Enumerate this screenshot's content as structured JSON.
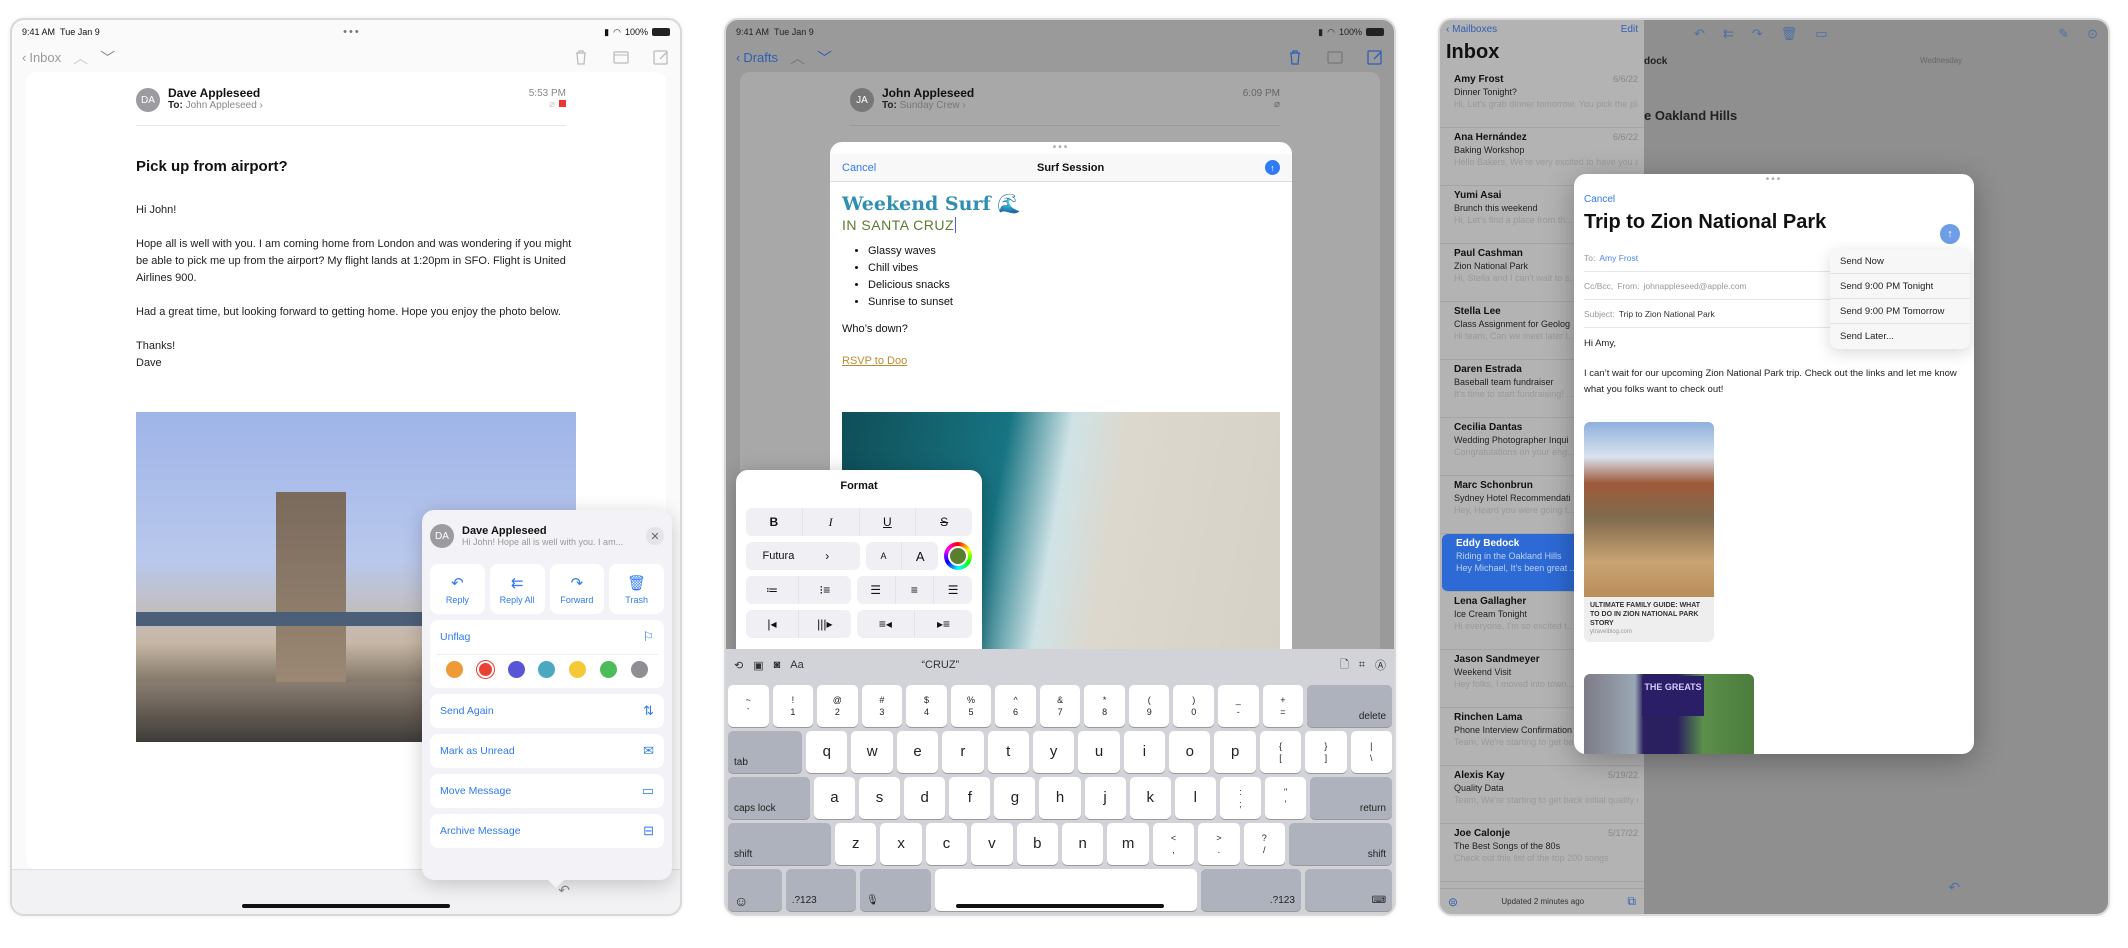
{
  "status_bar": {
    "time": "9:41 AM",
    "date": "Tue Jan 9",
    "battery": "100%"
  },
  "panel1": {
    "nav": {
      "back_label": "Inbox"
    },
    "message": {
      "avatar_initials": "DA",
      "sender": "Dave Appleseed",
      "to_label": "To:",
      "to": "John Appleseed",
      "time": "5:53 PM",
      "subject": "Pick up from airport?",
      "body": [
        "Hi John!",
        "Hope all is well with you. I am coming home from London and was wondering if you might be able to pick me up from the airport? My flight lands at 1:20pm in SFO. Flight is United Airlines 900.",
        "Had a great time, but looking forward to getting home. Hope you enjoy the photo below.",
        "Thanks!\nDave"
      ]
    },
    "popover": {
      "sender": "Dave Appleseed",
      "preview": "Hi John! Hope all is well with you. I am...",
      "close_glyph": "✕",
      "actions": [
        {
          "label": "Reply",
          "icon": "reply-icon",
          "glyph": "↶"
        },
        {
          "label": "Reply All",
          "icon": "reply-all-icon",
          "glyph": "⇇"
        },
        {
          "label": "Forward",
          "icon": "forward-icon",
          "glyph": "↷"
        },
        {
          "label": "Trash",
          "icon": "trash-icon",
          "glyph": "🗑"
        }
      ],
      "unflag_label": "Unflag",
      "flag_colors": [
        "#f09a37",
        "#eb4034",
        "#5856d6",
        "#4aa8c0",
        "#f5c935",
        "#4cbb5a",
        "#8e8e93"
      ],
      "selected_flag_color": "#eb4034",
      "menu": [
        {
          "label": "Send Again",
          "icon": "send-again-icon",
          "glyph": "⇅"
        },
        {
          "label": "Mark as Unread",
          "icon": "envelope-unread-icon",
          "glyph": "✉"
        },
        {
          "label": "Move Message",
          "icon": "folder-icon",
          "glyph": "▭"
        },
        {
          "label": "Archive Message",
          "icon": "archive-box-icon",
          "glyph": "⊟"
        }
      ]
    }
  },
  "panel2": {
    "nav": {
      "back_label": "Drafts"
    },
    "message": {
      "avatar_initials": "JA",
      "sender": "John Appleseed",
      "to_label": "To:",
      "to": "Sunday Crew",
      "time": "6:09 PM"
    },
    "compose": {
      "cancel_label": "Cancel",
      "title": "Surf Session",
      "heading": "Weekend Surf 🌊",
      "subheading": "IN SANTA CRUZ",
      "bullets": [
        "Glassy waves",
        "Chill vibes",
        "Delicious snacks",
        "Sunrise to sunset"
      ],
      "question": "Who’s down?",
      "link": "RSVP to Doo"
    },
    "format": {
      "title": "Format",
      "styles": [
        "B",
        "I",
        "U",
        "S"
      ],
      "font": "Futura",
      "size_small": "A",
      "size_large": "A",
      "text_color": "#5b7d2e"
    },
    "keyboard": {
      "suggestion": "“CRUZ”",
      "toolbar_aa": "Aa",
      "row1": [
        [
          "~",
          "`"
        ],
        [
          "!",
          "1"
        ],
        [
          "@",
          "2"
        ],
        [
          "#",
          "3"
        ],
        [
          "$",
          "4"
        ],
        [
          "%",
          "5"
        ],
        [
          "^",
          "6"
        ],
        [
          "&",
          "7"
        ],
        [
          "*",
          "8"
        ],
        [
          "(",
          "9"
        ],
        [
          ")",
          "0"
        ],
        [
          "_",
          "-"
        ],
        [
          "+",
          "="
        ]
      ],
      "delete": "delete",
      "tab": "tab",
      "row2": [
        "q",
        "w",
        "e",
        "r",
        "t",
        "y",
        "u",
        "i",
        "o",
        "p"
      ],
      "row2_extra": [
        [
          "{",
          "["
        ],
        [
          "}",
          "]"
        ],
        [
          "|",
          "\\"
        ]
      ],
      "caps": "caps lock",
      "row3": [
        "a",
        "s",
        "d",
        "f",
        "g",
        "h",
        "j",
        "k",
        "l"
      ],
      "row3_extra": [
        [
          ":",
          ";"
        ],
        [
          "\"",
          "'"
        ]
      ],
      "return": "return",
      "shift": "shift",
      "row4": [
        "z",
        "x",
        "c",
        "v",
        "b",
        "n",
        "m"
      ],
      "row4_extra": [
        [
          "<",
          ","
        ],
        [
          ">",
          "."
        ],
        [
          "?",
          "/"
        ]
      ],
      "numbers": ".?123"
    }
  },
  "panel3": {
    "sidebar": {
      "back_label": "Mailboxes",
      "edit_label": "Edit",
      "title": "Inbox",
      "footer": "Updated 2 minutes ago",
      "items": [
        {
          "from": "Amy Frost",
          "date": "6/6/22",
          "subject": "Dinner Tonight?",
          "preview": "Hi, Let's grab dinner tomorrow. You pick the place!"
        },
        {
          "from": "Ana Hernández",
          "date": "6/6/22",
          "subject": "Baking Workshop",
          "preview": "Hello Bakers, We're very excited to have you all join us for our baking work..."
        },
        {
          "from": "Yumi Asai",
          "date": "",
          "subject": "Brunch this weekend",
          "preview": "Hi, Let's find a place from th... this weekend. I can't want to..."
        },
        {
          "from": "Paul Cashman",
          "date": "",
          "subject": "Zion National Park",
          "preview": "Hi, Stella and I can't wait to s... week at Zion. I'm including s..."
        },
        {
          "from": "Stella Lee",
          "date": "",
          "subject": "Class Assignment for Geolog",
          "preview": "Hi team, Can we meet later t... started on our final team pro..."
        },
        {
          "from": "Daren Estrada",
          "date": "",
          "subject": "Baseball team fundraiser",
          "preview": "It's time to start fundraising! ... some examples on fundraisi..."
        },
        {
          "from": "Cecilia Dantas",
          "date": "",
          "subject": "Wedding Photographer Inqui",
          "preview": "Congratulations on your eng... thank you for your interest in..."
        },
        {
          "from": "Marc Schonbrun",
          "date": "",
          "subject": "Sydney Hotel Recommendati",
          "preview": "Hey, Heard you were going t... Sydney, Australia next month..."
        },
        {
          "from": "Eddy Bedock",
          "date": "",
          "subject": "Riding in the Oakland Hills",
          "preview": "Hey Michael, It's been great ... riding weather lately, perfect...",
          "selected": true
        },
        {
          "from": "Lena Gallagher",
          "date": "",
          "subject": "Ice Cream Tonight",
          "preview": "Hi everyone, I'm so excited t... tonight. Parking can be toug..."
        },
        {
          "from": "Jason Sandmeyer",
          "date": "",
          "subject": "Weekend Visit",
          "preview": "Hey folks, I moved into town... starting next week. How's ev..."
        },
        {
          "from": "Rinchen Lama",
          "date": "",
          "subject": "Phone Interview Confirmation",
          "preview": "Team, We're starting to get back initial quality da..."
        },
        {
          "from": "Alexis Kay",
          "date": "5/19/22",
          "subject": "Quality Data",
          "preview": "Team, We're starting to get back initial quality data from our partners and early te..."
        },
        {
          "from": "Joe Calonje",
          "date": "5/17/22",
          "subject": "The Best Songs of the 80s",
          "preview": "Check out this list of the top 200 songs"
        }
      ]
    },
    "detail": {
      "from_partial": "dock",
      "day": "Wednesday",
      "subject_partial": "e Oakland Hills"
    },
    "compose": {
      "cancel_label": "Cancel",
      "title": "Trip to Zion National Park",
      "to_label": "To:",
      "to": "Amy Frost",
      "ccbcc_label": "Cc/Bcc,",
      "from_label": "From:",
      "from": "johnappleseed@apple.com",
      "subject_label": "Subject:",
      "subject": "Trip to Zion National Park",
      "greeting": "Hi Amy,",
      "body": "I can’t wait for our upcoming Zion National Park trip.  Check out the links and let me know what you folks want to check out!",
      "link_title": "ULTIMATE FAMILY GUIDE: WHAT TO DO IN ZION NATIONAL PARK STORY",
      "link_source": "ytravelblog.com",
      "link2_badge": "THE GREATS",
      "send_menu": [
        "Send Now",
        "Send 9:00 PM Tonight",
        "Send 9:00 PM Tomorrow",
        "Send Later..."
      ]
    }
  }
}
